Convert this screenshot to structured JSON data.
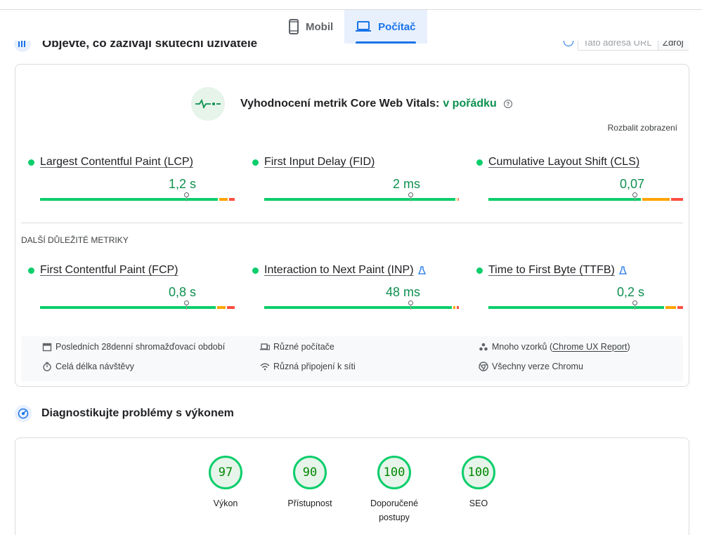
{
  "tabs": [
    {
      "label": "Mobil",
      "icon": "smartphone-icon",
      "active": false
    },
    {
      "label": "Počítač",
      "icon": "laptop-icon",
      "active": true
    }
  ],
  "hidden_section": {
    "title": "Objevte, co zažívají skuteční uživatelé",
    "url_placeholder": "Tato adresa URL",
    "url_button": "Zdroj"
  },
  "cwv": {
    "title": "Vyhodnocení metrik Core Web Vitals:",
    "status": "v pořádku",
    "expand_label": "Rozbalit zobrazení"
  },
  "core_metrics": [
    {
      "name": "Largest Contentful Paint (LCP)",
      "value": "1,2 s",
      "good_fraction": 0.92,
      "ni_fraction": 0.05,
      "poor_fraction": 0.03,
      "marker": 0.75
    },
    {
      "name": "First Input Delay (FID)",
      "value": "2 ms",
      "good_fraction": 0.99,
      "ni_fraction": 0.005,
      "poor_fraction": 0.005,
      "marker": 0.75
    },
    {
      "name": "Cumulative Layout Shift (CLS)",
      "value": "0,07",
      "good_fraction": 0.79,
      "ni_fraction": 0.15,
      "poor_fraction": 0.06,
      "marker": 0.75
    }
  ],
  "other_metrics_heading": "DALŠÍ DŮLEŽITÉ METRIKY",
  "other_metrics": [
    {
      "name": "First Contentful Paint (FCP)",
      "value": "0,8 s",
      "experimental": false,
      "good_fraction": 0.91,
      "ni_fraction": 0.05,
      "poor_fraction": 0.04,
      "marker": 0.75
    },
    {
      "name": "Interaction to Next Paint (INP)",
      "value": "48 ms",
      "experimental": true,
      "good_fraction": 0.97,
      "ni_fraction": 0.02,
      "poor_fraction": 0.01,
      "marker": 0.75
    },
    {
      "name": "Time to First Byte (TTFB)",
      "value": "0,2 s",
      "experimental": true,
      "good_fraction": 0.91,
      "ni_fraction": 0.06,
      "poor_fraction": 0.03,
      "marker": 0.75
    }
  ],
  "footer": {
    "period": "Posledních 28denní shromažďovací období",
    "devices": "Různé počítače",
    "samples_prefix": "Mnoho vzorků (",
    "samples_link": "Chrome UX Report",
    "samples_suffix": ")",
    "duration": "Celá délka návštěvy",
    "network": "Různá připojení k síti",
    "chrome": "Všechny verze Chromu"
  },
  "diagnose": {
    "title": "Diagnostikujte problémy s výkonem"
  },
  "scores": [
    {
      "score": "97",
      "label": "Výkon"
    },
    {
      "score": "90",
      "label": "Přístupnost"
    },
    {
      "score": "100",
      "label": "Doporučené postupy"
    },
    {
      "score": "100",
      "label": "SEO"
    }
  ],
  "colors": {
    "good": "#0cce6b",
    "needs_improvement": "#ffa400",
    "poor": "#ff4e42",
    "accent": "#1a73e8"
  }
}
